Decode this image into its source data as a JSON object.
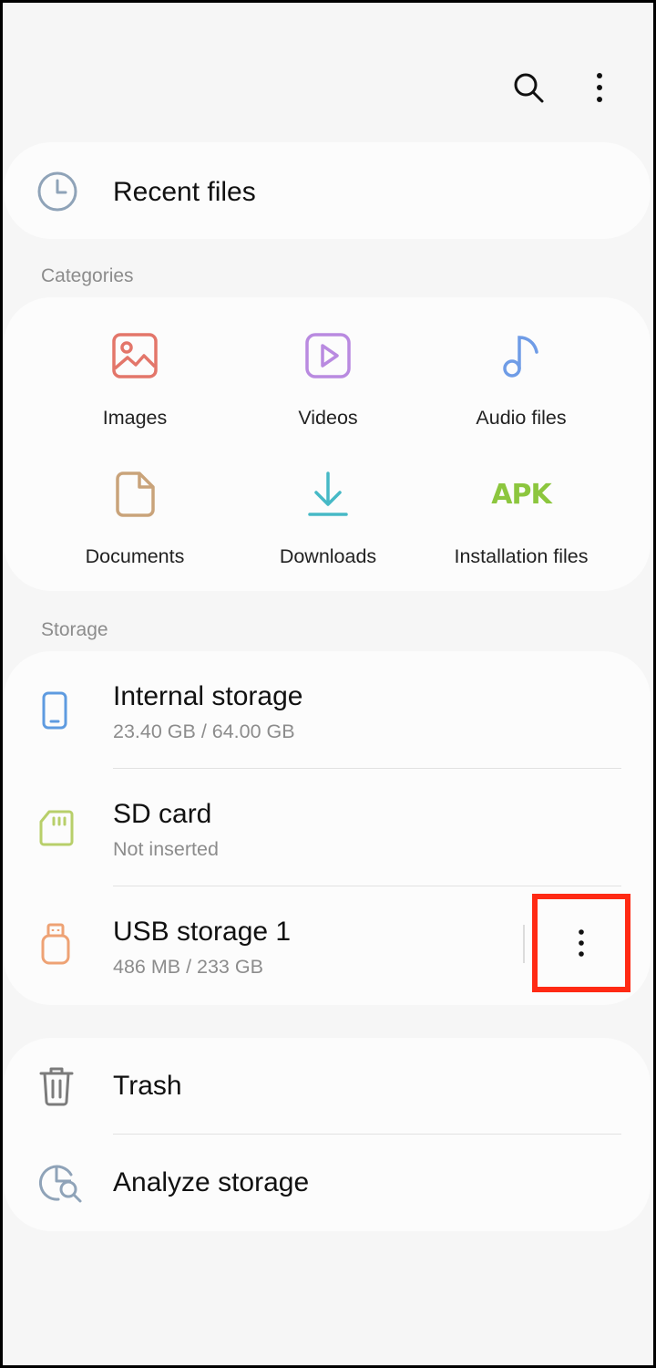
{
  "toolbar": {
    "search_icon": "search-icon",
    "more_icon": "more-vertical-icon"
  },
  "recent": {
    "label": "Recent files",
    "icon": "clock-icon"
  },
  "categories": {
    "header": "Categories",
    "items": [
      {
        "label": "Images",
        "icon": "image-icon",
        "color": "#e3766a"
      },
      {
        "label": "Videos",
        "icon": "video-icon",
        "color": "#b98ae0"
      },
      {
        "label": "Audio files",
        "icon": "music-note-icon",
        "color": "#6f9ce6"
      },
      {
        "label": "Documents",
        "icon": "document-icon",
        "color": "#c9a37a"
      },
      {
        "label": "Downloads",
        "icon": "download-icon",
        "color": "#46b9c6"
      },
      {
        "label": "Installation files",
        "icon": "apk-icon",
        "glyph": "APK",
        "color": "#8cc63e"
      }
    ]
  },
  "storage": {
    "header": "Storage",
    "items": [
      {
        "title": "Internal storage",
        "sub": "23.40 GB / 64.00 GB",
        "icon": "phone-icon",
        "color": "#5e9be0"
      },
      {
        "title": "SD card",
        "sub": "Not inserted",
        "icon": "sd-card-icon",
        "color": "#b8cf6a"
      },
      {
        "title": "USB storage 1",
        "sub": "486 MB / 233 GB",
        "icon": "usb-drive-icon",
        "color": "#eea274"
      }
    ]
  },
  "tools": {
    "items": [
      {
        "title": "Trash",
        "icon": "trash-icon"
      },
      {
        "title": "Analyze storage",
        "icon": "analyze-storage-icon"
      }
    ]
  },
  "colors": {
    "background": "#f6f6f6",
    "card": "#fcfcfc",
    "highlight": "#ff2a14",
    "secondary_text": "#8c8c8c"
  }
}
